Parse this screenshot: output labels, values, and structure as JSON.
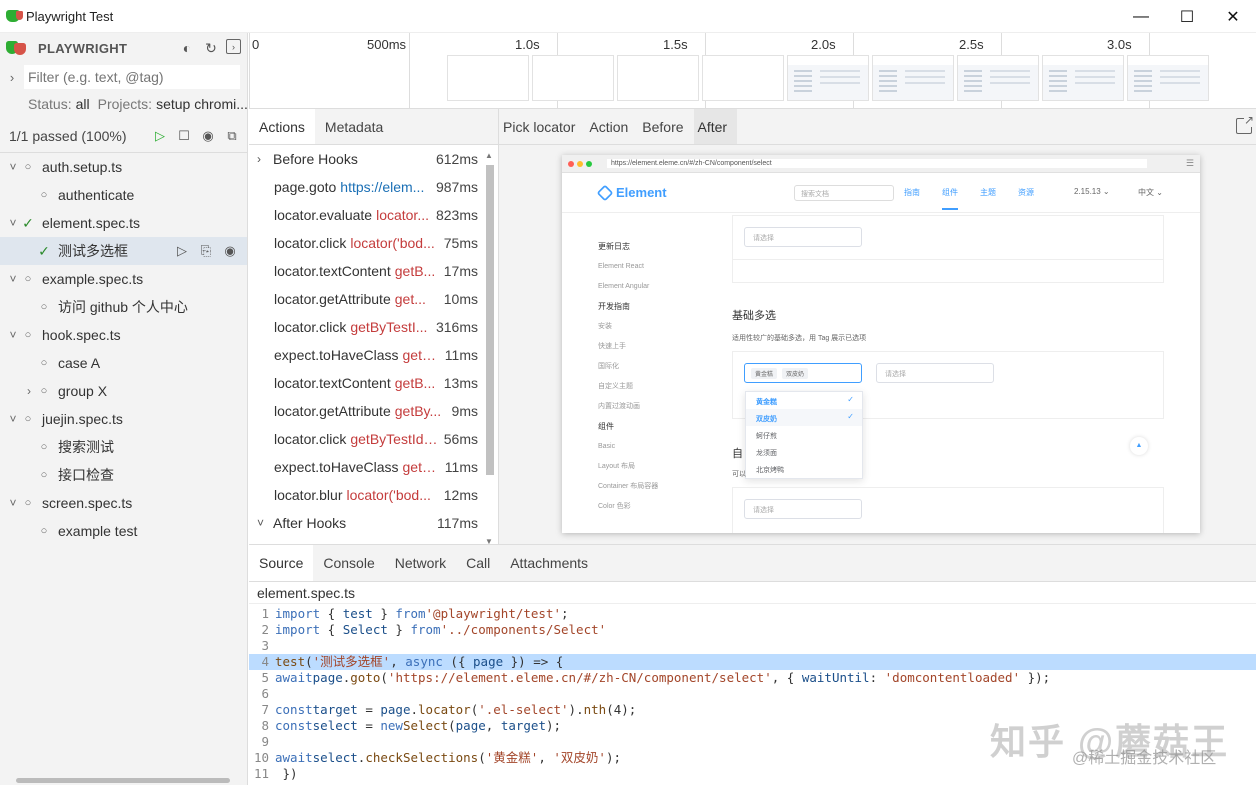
{
  "window": {
    "title": "Playwright Test",
    "minimize": "—",
    "maximize": "☐",
    "close": "✕"
  },
  "sidebar": {
    "brand": "PLAYWRIGHT",
    "filter_placeholder": "Filter (e.g. text, @tag)",
    "status_label": "Status:",
    "status_value": "all",
    "projects_label": "Projects:",
    "projects_value": "setup chromi...",
    "passed": "1/1 passed (100%)",
    "tree": [
      {
        "label": "auth.setup.ts",
        "level": 0,
        "twisty": "˅",
        "status": "○"
      },
      {
        "label": "authenticate",
        "level": 1,
        "twisty": "",
        "status": "○"
      },
      {
        "label": "element.spec.ts",
        "level": 0,
        "twisty": "˅",
        "status": "✓"
      },
      {
        "label": "测试多选框",
        "level": 1,
        "twisty": "",
        "status": "✓",
        "selected": true
      },
      {
        "label": "example.spec.ts",
        "level": 0,
        "twisty": "˅",
        "status": "○"
      },
      {
        "label": "访问 github 个人中心",
        "level": 1,
        "twisty": "",
        "status": "○"
      },
      {
        "label": "hook.spec.ts",
        "level": 0,
        "twisty": "˅",
        "status": "○"
      },
      {
        "label": "case A",
        "level": 1,
        "twisty": "",
        "status": "○"
      },
      {
        "label": "group X",
        "level": 1,
        "twisty": "›",
        "status": "○"
      },
      {
        "label": "juejin.spec.ts",
        "level": 0,
        "twisty": "˅",
        "status": "○"
      },
      {
        "label": "搜索测试",
        "level": 1,
        "twisty": "",
        "status": "○"
      },
      {
        "label": "接口检查",
        "level": 1,
        "twisty": "",
        "status": "○"
      },
      {
        "label": "screen.spec.ts",
        "level": 0,
        "twisty": "˅",
        "status": "○"
      },
      {
        "label": "example test",
        "level": 1,
        "twisty": "",
        "status": "○"
      }
    ]
  },
  "timeline": {
    "ticks": [
      "0",
      "500ms",
      "1.0s",
      "1.5s",
      "2.0s",
      "2.5s",
      "3.0s"
    ]
  },
  "actions_panel": {
    "tabs": [
      "Actions",
      "Metadata"
    ],
    "items": [
      {
        "name": "Before Hooks",
        "arg": "",
        "time": "612ms",
        "hook": true,
        "chev": "›"
      },
      {
        "name": "page.goto",
        "arg": "https://elem...",
        "time": "987ms",
        "link": true
      },
      {
        "name": "locator.evaluate",
        "arg": "locator...",
        "time": "823ms"
      },
      {
        "name": "locator.click",
        "arg": "locator('bod...",
        "time": "75ms"
      },
      {
        "name": "locator.textContent",
        "arg": "getB...",
        "time": "17ms"
      },
      {
        "name": "locator.getAttribute",
        "arg": "get...",
        "time": "10ms"
      },
      {
        "name": "locator.click",
        "arg": "getByTestI...",
        "time": "316ms"
      },
      {
        "name": "expect.toHaveClass",
        "arg": "getB...",
        "time": "11ms"
      },
      {
        "name": "locator.textContent",
        "arg": "getB...",
        "time": "13ms"
      },
      {
        "name": "locator.getAttribute",
        "arg": "getBy...",
        "time": "9ms"
      },
      {
        "name": "locator.click",
        "arg": "getByTestId(...",
        "time": "56ms"
      },
      {
        "name": "expect.toHaveClass",
        "arg": "getB...",
        "time": "11ms"
      },
      {
        "name": "locator.blur",
        "arg": "locator('bod...",
        "time": "12ms"
      },
      {
        "name": "After Hooks",
        "arg": "",
        "time": "117ms",
        "hook": true,
        "chev": "˅"
      }
    ]
  },
  "snapshot_panel": {
    "tabs": [
      "Pick locator",
      "Action",
      "Before",
      "After"
    ],
    "page": {
      "url": "https://element.eleme.cn/#/zh-CN/component/select",
      "logo": "Element",
      "search_placeholder": "搜索文档",
      "nav": [
        "指南",
        "组件",
        "主题",
        "资源"
      ],
      "version": "2.15.13 ⌄",
      "lang": "中文 ⌄",
      "side": [
        "更新日志",
        "Element React",
        "Element Angular",
        "开发指南",
        "安装",
        "快速上手",
        "国际化",
        "自定义主题",
        "内置过渡动画",
        "组件",
        "Basic",
        "Layout 布局",
        "Container 布局容器",
        "Color 色彩"
      ],
      "select_placeholder": "请选择",
      "section_title": "基础多选",
      "section_desc": "适用性较广的基础多选，用 Tag 展示已选项",
      "tags": [
        "黄金糕",
        "双皮奶"
      ],
      "options": [
        "黄金糕",
        "双皮奶",
        "蚵仔煎",
        "龙须面",
        "北京烤鸭"
      ],
      "partial_title": "自",
      "partial_desc": "可以"
    }
  },
  "source_panel": {
    "tabs": [
      "Source",
      "Console",
      "Network",
      "Call",
      "Attachments"
    ],
    "filename": "element.spec.ts"
  },
  "watermark": {
    "main": "知乎 @蘑菇王",
    "sub": "@稀土掘金技术社区"
  }
}
